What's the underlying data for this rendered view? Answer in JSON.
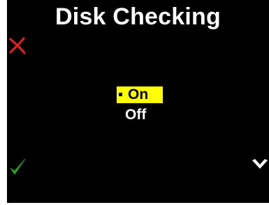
{
  "screen": {
    "title": "Disk Checking",
    "background_color": "#000000",
    "text_color": "#ffffff"
  },
  "actions": {
    "cancel": {
      "icon": "red-x-cancel-icon",
      "color": "#e02020"
    },
    "confirm": {
      "icon": "green-checkmark-icon",
      "color": "#2ea62e"
    },
    "next": {
      "icon": "down-chevron-icon",
      "color": "#ffffff"
    }
  },
  "menu": {
    "highlight_color": "#ffff00",
    "options": [
      {
        "label": "On",
        "selected": true
      },
      {
        "label": "Off",
        "selected": false
      }
    ]
  }
}
